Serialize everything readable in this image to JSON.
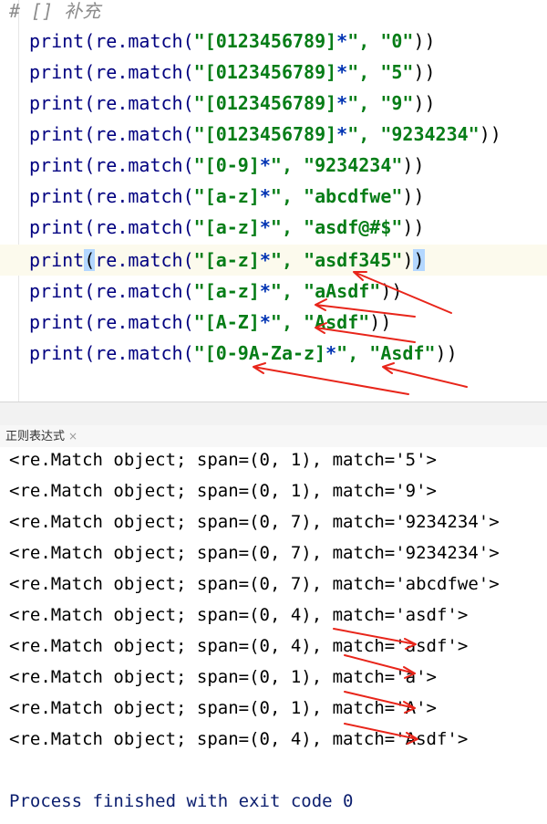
{
  "editor": {
    "comment": "# [] 补充",
    "lines": [
      {
        "fn": "print(re.match(",
        "pattern": "\"[0123456789]",
        "star": "*",
        "sep": "\", ",
        "arg": "\"0\"",
        "close": "))"
      },
      {
        "fn": "print(re.match(",
        "pattern": "\"[0123456789]",
        "star": "*",
        "sep": "\", ",
        "arg": "\"5\"",
        "close": "))"
      },
      {
        "fn": "print(re.match(",
        "pattern": "\"[0123456789]",
        "star": "*",
        "sep": "\", ",
        "arg": "\"9\"",
        "close": "))"
      },
      {
        "fn": "print(re.match(",
        "pattern": "\"[0123456789]",
        "star": "*",
        "sep": "\", ",
        "arg": "\"9234234\"",
        "close": "))"
      },
      {
        "fn": "print(re.match(",
        "pattern": "\"[0-9]",
        "star": "*",
        "sep": "\", ",
        "arg": "\"9234234\"",
        "close": "))"
      },
      {
        "fn": "print(re.match(",
        "pattern": "\"[a-z]",
        "star": "*",
        "sep": "\", ",
        "arg": "\"abcdfwe\"",
        "close": "))"
      },
      {
        "fn": "print(re.match(",
        "pattern": "\"[a-z]",
        "star": "*",
        "sep": "\", ",
        "arg": "\"asdf@#$\"",
        "close": "))"
      },
      {
        "fn": "print",
        "open": "(",
        "fn2": "re.match(",
        "pattern": "\"[a-z]",
        "star": "*",
        "sep": "\", ",
        "arg": "\"asdf345\"",
        "close1": ")",
        "close": ")"
      },
      {
        "fn": "print(re.match(",
        "pattern": "\"[a-z]",
        "star": "*",
        "sep": "\", ",
        "arg": "\"aAsdf\"",
        "close": "))"
      },
      {
        "fn": "print(re.match(",
        "pattern": "\"[A-Z]",
        "star": "*",
        "sep": "\", ",
        "arg": "\"Asdf\"",
        "close": "))"
      },
      {
        "fn": "print(re.match(",
        "pattern": "\"[0-9A-Za-z]",
        "star": "*",
        "sep": "\", ",
        "arg": "\"Asdf\"",
        "close": "))"
      }
    ]
  },
  "tab": {
    "label": "正则表达式",
    "close": "×"
  },
  "console": {
    "lines": [
      "<re.Match object; span=(0, 1), match='5'>",
      "<re.Match object; span=(0, 1), match='9'>",
      "<re.Match object; span=(0, 7), match='9234234'>",
      "<re.Match object; span=(0, 7), match='9234234'>",
      "<re.Match object; span=(0, 7), match='abcdfwe'>",
      "<re.Match object; span=(0, 4), match='asdf'>",
      "<re.Match object; span=(0, 4), match='asdf'>",
      "<re.Match object; span=(0, 1), match='a'>",
      "<re.Match object; span=(0, 1), match='A'>",
      "<re.Match object; span=(0, 4), match='Asdf'>"
    ],
    "process": "Process finished with exit code 0"
  },
  "colors": {
    "arrow": "#e8251a",
    "string": "#067d17",
    "keyword": "#000080"
  }
}
